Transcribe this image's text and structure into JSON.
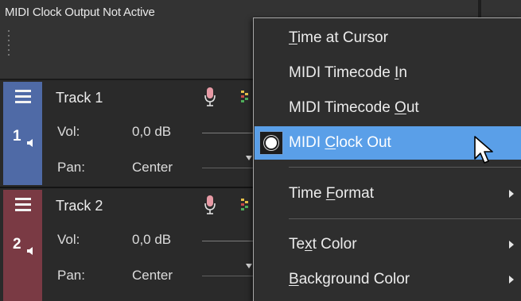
{
  "status": {
    "text": "MIDI Clock Output Not Active"
  },
  "tracks": [
    {
      "name": "Track 1",
      "number": "1",
      "vol_label": "Vol:",
      "vol_value": "0,0 dB",
      "pan_label": "Pan:",
      "pan_value": "Center",
      "color": "#4f6aa6"
    },
    {
      "name": "Track 2",
      "number": "2",
      "vol_label": "Vol:",
      "vol_value": "0,0 dB",
      "pan_label": "Pan:",
      "pan_value": "Center",
      "color": "#7a3a44"
    }
  ],
  "menu": {
    "items": [
      {
        "pre": "",
        "accel": "T",
        "post": "ime at Cursor",
        "selected": false,
        "submenu": false
      },
      {
        "pre": "MIDI Timecode ",
        "accel": "I",
        "post": "n",
        "selected": false,
        "submenu": false
      },
      {
        "pre": "MIDI Timecode ",
        "accel": "O",
        "post": "ut",
        "selected": false,
        "submenu": false
      },
      {
        "pre": "MIDI ",
        "accel": "C",
        "post": "lock Out",
        "selected": true,
        "submenu": false
      },
      {
        "pre": "Time ",
        "accel": "F",
        "post": "ormat",
        "selected": false,
        "submenu": true
      },
      {
        "pre": "Te",
        "accel": "x",
        "post": "t Color",
        "selected": false,
        "submenu": true
      },
      {
        "pre": "",
        "accel": "B",
        "post": "ackground Color",
        "selected": false,
        "submenu": true
      }
    ],
    "highlight_color": "#5a9fe8"
  }
}
